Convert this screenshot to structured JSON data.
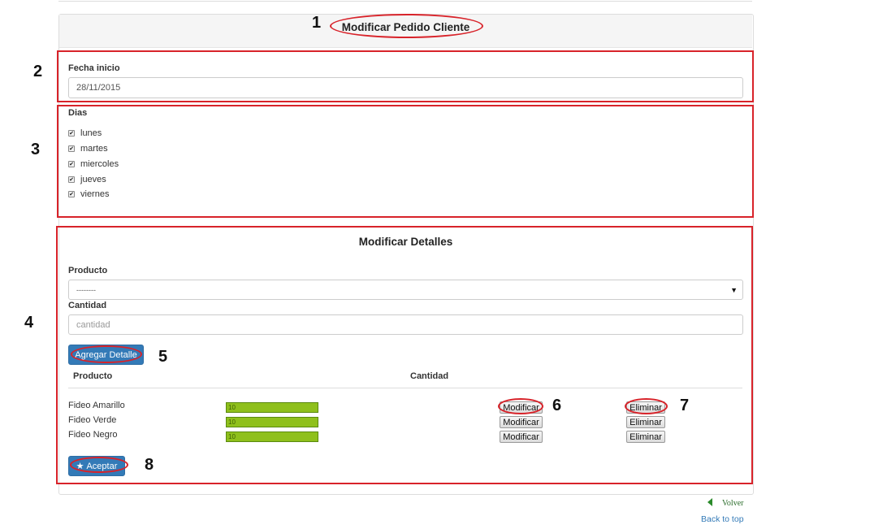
{
  "header": {
    "title": "Modificar Pedido Cliente"
  },
  "annotations": [
    "1",
    "2",
    "3",
    "4",
    "5",
    "6",
    "7",
    "8"
  ],
  "fecha": {
    "label": "Fecha inicio",
    "value": "28/11/2015"
  },
  "dias": {
    "label": "Dias",
    "items": [
      {
        "label": "lunes",
        "checked": true
      },
      {
        "label": "martes",
        "checked": true
      },
      {
        "label": "miercoles",
        "checked": true
      },
      {
        "label": "jueves",
        "checked": true
      },
      {
        "label": "viernes",
        "checked": true
      }
    ]
  },
  "detalles": {
    "title": "Modificar Detalles",
    "producto_label": "Producto",
    "producto_selected": "--------",
    "cantidad_label": "Cantidad",
    "cantidad_placeholder": "cantidad",
    "add_button": "Agregar Detalle",
    "table": {
      "headers": [
        "Producto",
        "Cantidad"
      ],
      "rows": [
        {
          "producto": "Fideo Amarillo",
          "cantidad": "10",
          "modificar": "Modificar",
          "eliminar": "Eliminar"
        },
        {
          "producto": "Fideo Verde",
          "cantidad": "10",
          "modificar": "Modificar",
          "eliminar": "Eliminar"
        },
        {
          "producto": "Fideo Negro",
          "cantidad": "10",
          "modificar": "Modificar",
          "eliminar": "Eliminar"
        }
      ]
    }
  },
  "accept_button": "Aceptar",
  "footer": {
    "back_link": "Volver",
    "top_link": "Back to top"
  },
  "colors": {
    "annotation": "#d8232a",
    "primary": "#337ab7",
    "quantity_fill": "#8fc01c"
  }
}
